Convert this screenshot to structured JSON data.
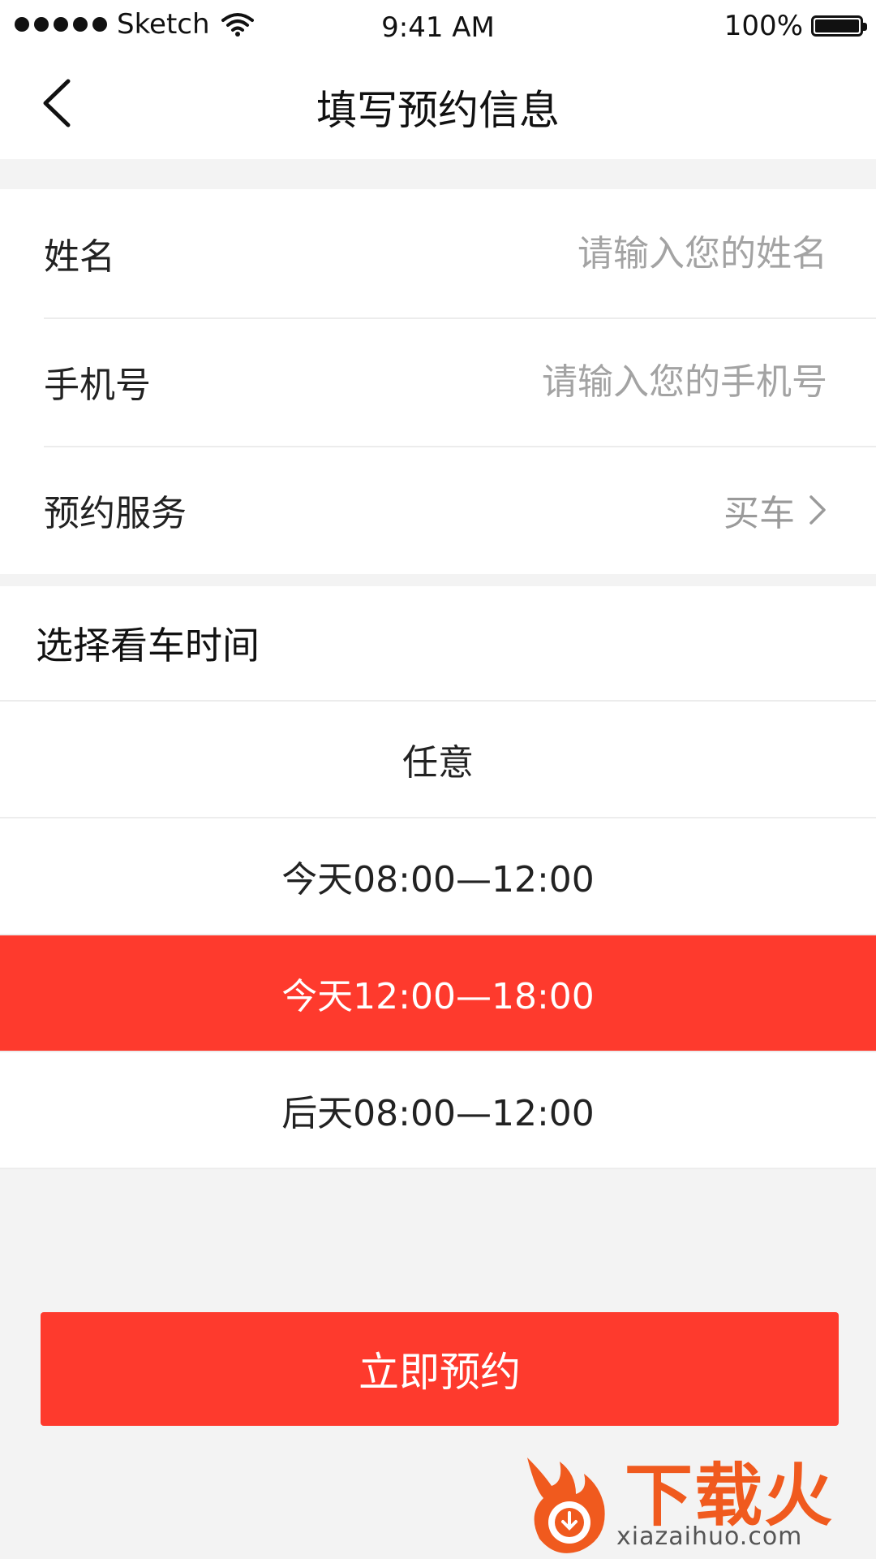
{
  "status_bar": {
    "carrier": "Sketch",
    "time": "9:41 AM",
    "battery": "100%"
  },
  "nav": {
    "title": "填写预约信息",
    "back_icon": "chevron-left-icon"
  },
  "form": {
    "name_label": "姓名",
    "name_placeholder": "请输入您的姓名",
    "phone_label": "手机号",
    "phone_placeholder": "请输入您的手机号",
    "service_label": "预约服务",
    "service_value": "买车"
  },
  "time_picker": {
    "title": "选择看车时间",
    "options": [
      "任意",
      "今天08:00—12:00",
      "今天12:00—18:00",
      "后天08:00—12:00"
    ],
    "selected_index": 2,
    "selected_color": "#fe3a2d"
  },
  "submit_label": "立即预约",
  "accent_color": "#fe3a2d",
  "watermark": {
    "text": "下载火",
    "url": "xiazaihuo.com"
  }
}
